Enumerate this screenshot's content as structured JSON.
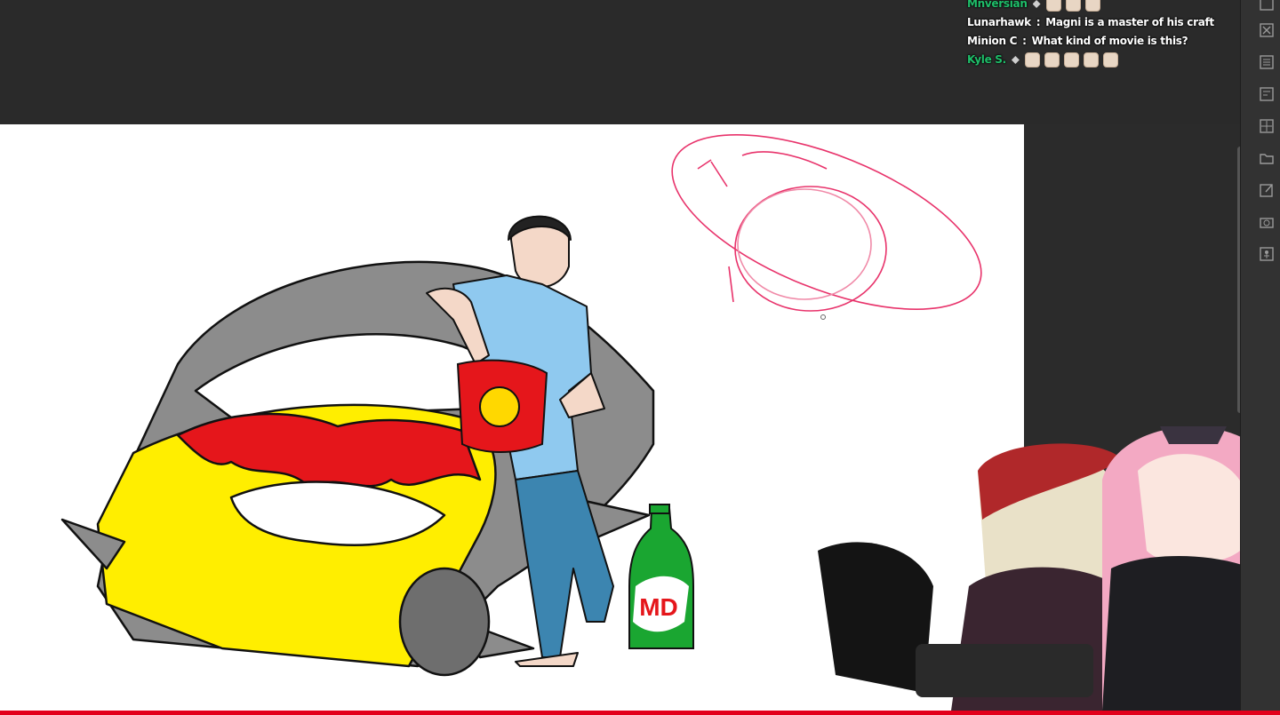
{
  "chat": {
    "messages": [
      {
        "user": "Mnversian",
        "user_color": "#1fbf6a",
        "text": "",
        "emotes": 3,
        "badge": true
      },
      {
        "user": "Lunarhawk",
        "user_color": "#ffffff",
        "text": "Magni is a master of his craft",
        "emotes": 0,
        "badge": false
      },
      {
        "user": "Minion C",
        "user_color": "#ffffff",
        "text": "What kind of movie is this?",
        "emotes": 0,
        "badge": false
      },
      {
        "user": "Kyle S.",
        "user_color": "#1fbf6a",
        "text": "",
        "emotes": 5,
        "badge": true
      }
    ]
  },
  "toolbar": {
    "icons": [
      "copy-icon",
      "close-layer-icon",
      "pattern-icon",
      "layer-panel-icon",
      "grid-icon",
      "folder-icon",
      "edit-icon",
      "camera-icon",
      "person-icon"
    ]
  },
  "drawing": {
    "bottle_label": "MD"
  },
  "colors": {
    "accent_red": "#e3001b",
    "sketch_pink": "#e8336b",
    "car_yellow": "#ffee00",
    "flame_red": "#e5161b",
    "shirt_blue": "#8fc9ef",
    "bottle_green": "#1aa631"
  }
}
